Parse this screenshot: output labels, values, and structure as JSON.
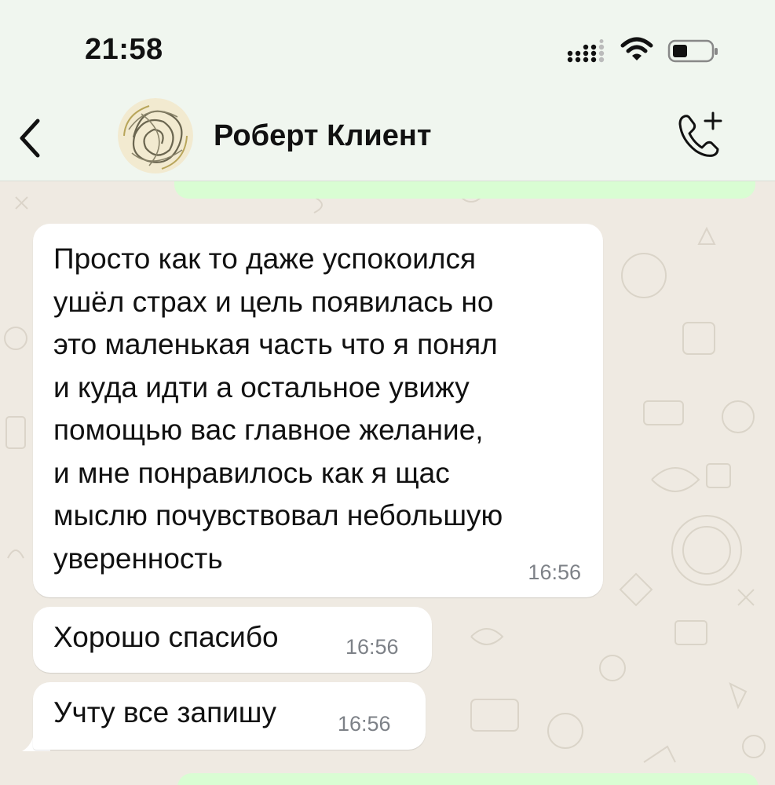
{
  "status_bar": {
    "time": "21:58"
  },
  "header": {
    "contact_name": "Роберт Клиент"
  },
  "messages": [
    {
      "direction": "incoming",
      "text": "Просто как то даже успокоился\nушёл страх и цель появилась но\nэто маленькая часть что я понял\nи куда идти а остальное увижу\nпомощью вас главное желание,\nи мне понравилось как я щас\nмыслю почувствовал небольшую\nуверенность",
      "time": "16:56"
    },
    {
      "direction": "incoming",
      "text": "Хорошо спасибо",
      "time": "16:56"
    },
    {
      "direction": "incoming",
      "text": "Учту все запишу",
      "time": "16:56"
    }
  ],
  "colors": {
    "header_bg": "#f0f6ef",
    "chat_bg": "#efeae2",
    "incoming_bubble": "#ffffff",
    "outgoing_bubble": "#d9fdd3"
  },
  "icons": [
    "signal-icon",
    "wifi-icon",
    "battery-icon",
    "back-icon",
    "avatar",
    "add-call-icon"
  ]
}
